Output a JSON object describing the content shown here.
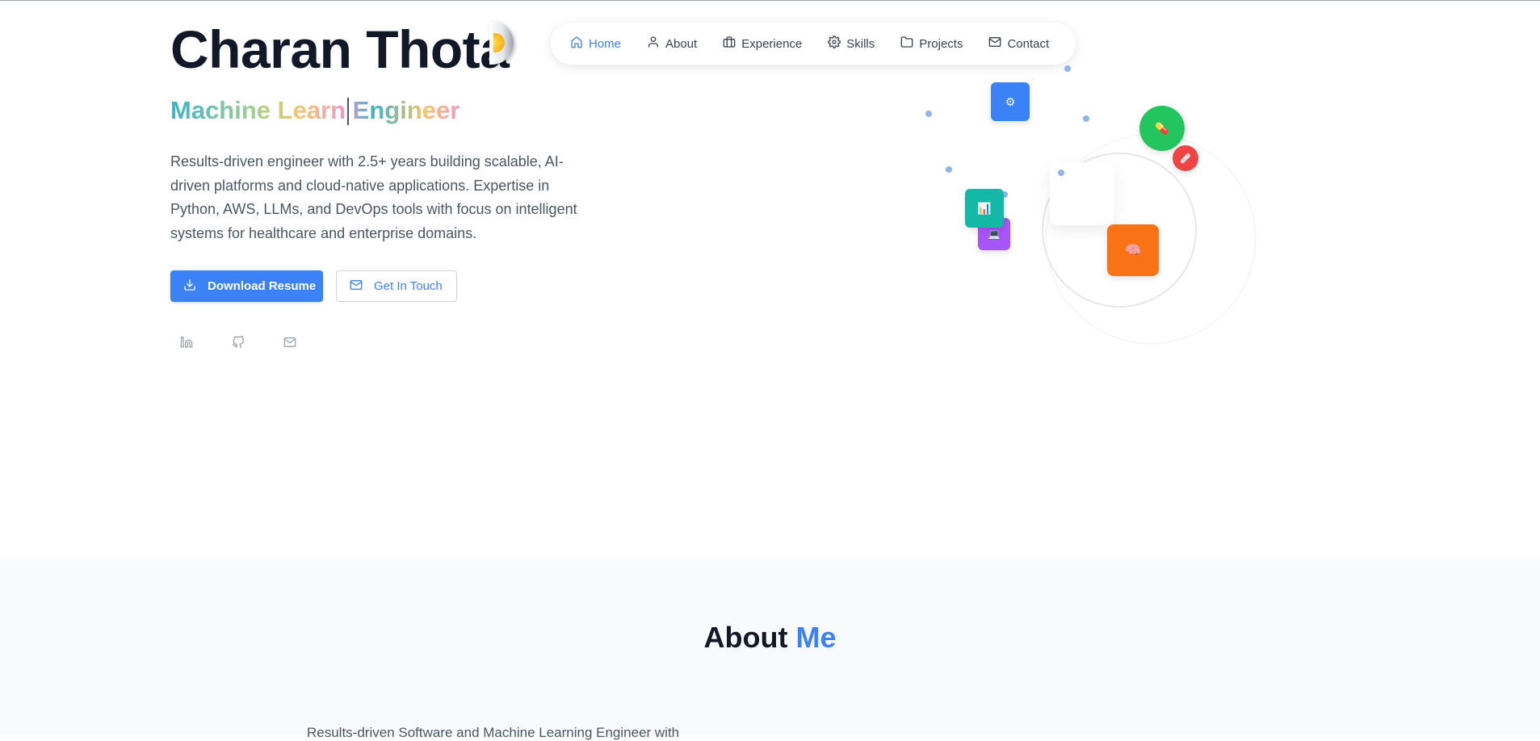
{
  "hero": {
    "name": "Charan Thota",
    "subtitle": "Machine Learn Engineer",
    "description": "Results-driven engineer with 2.5+ years building scalable, AI-driven platforms and cloud-native applications. Expertise in Python, AWS, LLMs, and DevOps tools with focus on intelligent systems for healthcare and enterprise domains.",
    "download_label": "Download Resume",
    "contact_label": "Get In Touch",
    "social_icons": [
      "linkedin-icon",
      "github-icon",
      "mail-icon"
    ]
  },
  "nav": {
    "items": [
      {
        "label": "Home",
        "icon": "home-icon",
        "active": true
      },
      {
        "label": "About",
        "icon": "user-icon",
        "active": false
      },
      {
        "label": "Experience",
        "icon": "briefcase-icon",
        "active": false
      },
      {
        "label": "Skills",
        "icon": "gear-icon",
        "active": false
      },
      {
        "label": "Projects",
        "icon": "folder-icon",
        "active": false
      },
      {
        "label": "Contact",
        "icon": "mail-icon",
        "active": false
      }
    ]
  },
  "decor": {
    "tiles": [
      {
        "icon": "gear-icon",
        "glyph": "⚙",
        "color": "#3b82f6"
      },
      {
        "icon": "pill-icon",
        "glyph": "💊",
        "color": "#22c55e"
      },
      {
        "icon": "bandage-icon",
        "glyph": "🩹",
        "color": "#ef4444"
      },
      {
        "icon": "chart-icon",
        "glyph": "📊",
        "color": "#14b8a6"
      },
      {
        "icon": "laptop-icon",
        "glyph": "💻",
        "color": "#a855f7"
      },
      {
        "icon": "brain-icon",
        "glyph": "🧠",
        "color": "#f97316"
      }
    ]
  },
  "about": {
    "title_main": "About",
    "title_accent": "Me",
    "intro": "Results-driven Software and Machine Learning Engineer with"
  },
  "colors": {
    "accent": "#3b82f6",
    "text_dark": "#111827",
    "text_body": "#4b5563"
  }
}
